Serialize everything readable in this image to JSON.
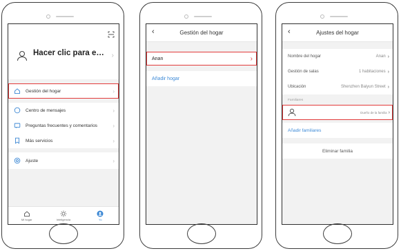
{
  "phone1": {
    "profile_text": "Hacer clic para estable...",
    "menu_home": "Gestión del hogar",
    "menu_messages": "Centro de mensajes",
    "menu_faq": "Preguntas frecuentes y comentarios",
    "menu_services": "Más servicios",
    "menu_settings": "Ajuste",
    "tabs": [
      "Mi hogar",
      "Inteligencia",
      "Yo"
    ]
  },
  "phone2": {
    "title": "Gestión del hogar",
    "home_name": "Anan",
    "add_home": "Añadir hogar"
  },
  "phone3": {
    "title": "Ajustes del hogar",
    "rows": [
      {
        "label": "Nombre del hogar",
        "value": "Anan"
      },
      {
        "label": "Gestión de salas",
        "value": "1 habitaciones"
      },
      {
        "label": "Ubicación",
        "value": "Shenzhen Baiyun Street"
      }
    ],
    "section_label": "Familiares",
    "member_role": "Dueño de la familia",
    "add_members": "Añadir familiares",
    "delete_family": "Eliminar familia"
  },
  "colors": {
    "highlight": "#e23a3a",
    "link": "#3d8ad7",
    "accent": "#3b87d4"
  }
}
